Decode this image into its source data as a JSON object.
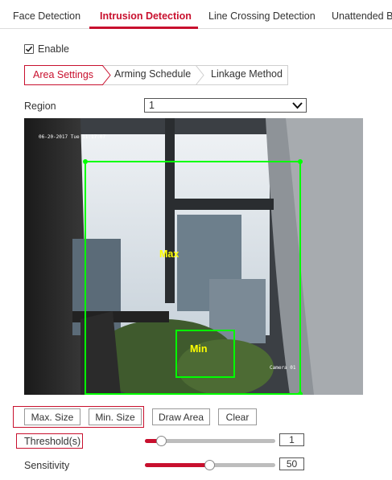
{
  "top_tabs": [
    "Face Detection",
    "Intrusion Detection",
    "Line Crossing Detection",
    "Unattended B"
  ],
  "active_tab_index": 1,
  "enable": {
    "label": "Enable",
    "checked": true
  },
  "sub_tabs": [
    "Area Settings",
    "Arming Schedule",
    "Linkage Method"
  ],
  "region": {
    "label": "Region",
    "value": "1"
  },
  "video": {
    "timestamp": "06-20-2017 Tue 11:17:07",
    "camera_name": "Camera 01",
    "max_label": "Max",
    "min_label": "Min"
  },
  "buttons": {
    "max_size": "Max. Size",
    "min_size": "Min. Size",
    "draw_area": "Draw Area",
    "clear": "Clear"
  },
  "threshold": {
    "label": "Threshold(s)",
    "value": "1",
    "fraction": 0.13
  },
  "sensitivity": {
    "label": "Sensitivity",
    "value": "50",
    "fraction": 0.5
  },
  "colors": {
    "accent": "#c8102e",
    "region_box": "#00ff00",
    "overlay_text": "#ffff00"
  }
}
